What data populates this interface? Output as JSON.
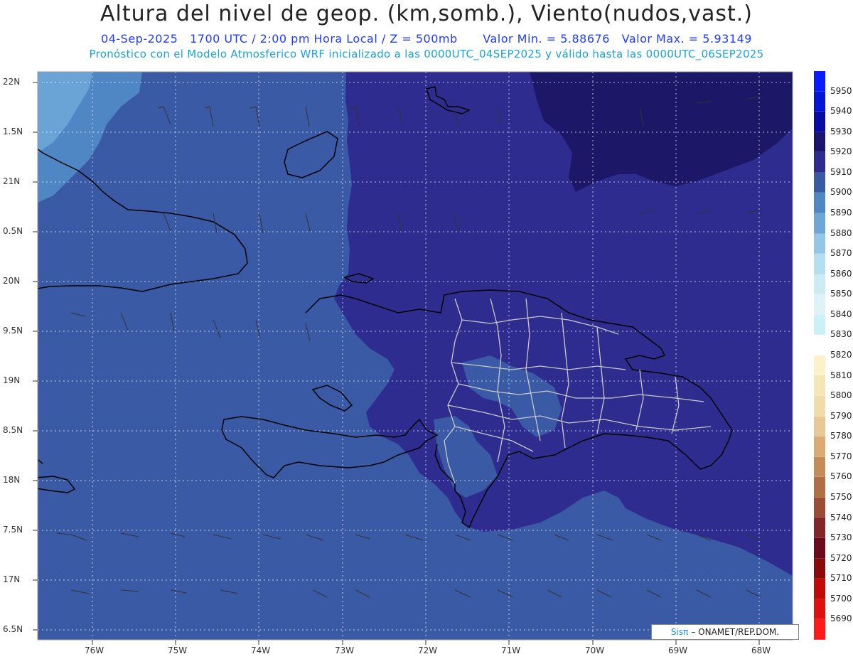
{
  "header": {
    "title": "Altura del nivel de geop. (km,somb.), Viento(nudos,vast.)",
    "date": "04-Sep-2025",
    "time": "1700 UTC / 2:00 pm Hora Local / Z = 500mb",
    "min_label": "Valor Min. = 5.88676",
    "max_label": "Valor Max. = 5.93149",
    "forecast_info": "Pronóstico con el Modelo Atmosferico WRF inicializado a las 0000UTC_04SEP2025 y válido hasta las  0000UTC_06SEP2025"
  },
  "map": {
    "lat_labels": [
      "22N",
      "1.5N",
      "21N",
      "0.5N",
      "20N",
      "9.5N",
      "19N",
      "8.5N",
      "18N",
      "7.5N",
      "17N",
      "6.5N"
    ],
    "lon_labels": [
      "76W",
      "75W",
      "74W",
      "73W",
      "72W",
      "71W",
      "70W",
      "69W",
      "68W"
    ],
    "colors": {
      "level_5900": "#3a5aa6",
      "level_5910": "#2e2c8f",
      "level_5920": "#1d1767",
      "level_5890": "#4f86c4",
      "level_5880": "#6aa3d6",
      "coast": "#000000",
      "provinces": "#c8c8c8",
      "grid": "#ffffff"
    }
  },
  "credit": {
    "brand": "Sisπ",
    "org": "– ONAMET/REP.DOM."
  },
  "colorbar": {
    "labels": [
      "5950",
      "5940",
      "5930",
      "5920",
      "5910",
      "5900",
      "5890",
      "5880",
      "5870",
      "5860",
      "5850",
      "5840",
      "5830",
      "5820",
      "5810",
      "5800",
      "5790",
      "5780",
      "5770",
      "5760",
      "5750",
      "5740",
      "5730",
      "5720",
      "5710",
      "5700",
      "5690"
    ],
    "colors": [
      "#0a1cff",
      "#0515d8",
      "#0a0aa5",
      "#1a1670",
      "#2e2c8f",
      "#3a5aa6",
      "#4f86c4",
      "#6fa6d8",
      "#94c6e6",
      "#b5dff0",
      "#cdebf5",
      "#dff2f8",
      "#ccf0f8",
      "#ffffff",
      "#fbf2cc",
      "#f5e6b8",
      "#f0dcaa",
      "#e8c896",
      "#d9aa73",
      "#c48c58",
      "#b06e47",
      "#9a4c36",
      "#82262a",
      "#6a0a1a",
      "#8a0a0a",
      "#c00a0a",
      "#e01010",
      "#ff1a1a"
    ]
  }
}
